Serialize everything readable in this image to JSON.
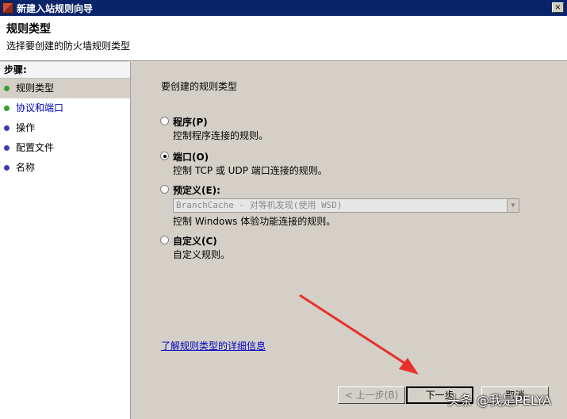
{
  "window": {
    "title": "新建入站规则向导",
    "close_symbol": "×"
  },
  "header": {
    "title": "规则类型",
    "subtitle": "选择要创建的防火墙规则类型"
  },
  "steps": {
    "heading": "步骤:",
    "items": [
      {
        "label": "规则类型",
        "status": "done"
      },
      {
        "label": "协议和端口",
        "status": "done"
      },
      {
        "label": "操作",
        "status": "pending"
      },
      {
        "label": "配置文件",
        "status": "pending"
      },
      {
        "label": "名称",
        "status": "pending"
      }
    ]
  },
  "main": {
    "prompt": "要创建的规则类型",
    "options": [
      {
        "label": "程序(P)",
        "desc": "控制程序连接的规则。",
        "selected": false
      },
      {
        "label": "端口(O)",
        "desc": "控制 TCP 或 UDP 端口连接的规则。",
        "selected": true
      },
      {
        "label": "预定义(E):",
        "desc": "控制 Windows 体验功能连接的规则。",
        "selected": false
      },
      {
        "label": "自定义(C)",
        "desc": "自定义规则。",
        "selected": false
      }
    ],
    "predefined_combo_value": "BranchCache - 对等机发现(使用 WSD)",
    "help_link": "了解规则类型的详细信息"
  },
  "buttons": {
    "back": "< 上一步(B)",
    "next": "下一步",
    "cancel": "取消"
  },
  "watermark": "头条 @我是PELYA",
  "colors": {
    "titlebar": "#0a246a",
    "link": "#0000c0",
    "arrow": "#e8302c",
    "step_done": "#34a034",
    "step_pending": "#3c3cb4"
  }
}
